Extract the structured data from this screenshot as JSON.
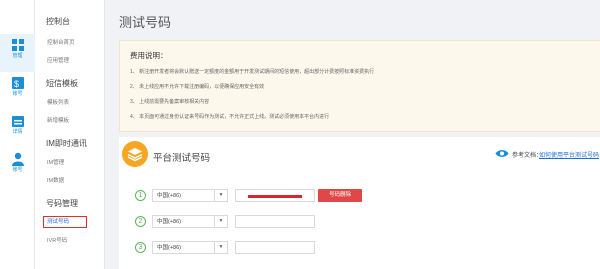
{
  "rail": [
    {
      "label": "管理",
      "icon": "grid-icon",
      "active": true
    },
    {
      "label": "账号",
      "icon": "account-icon",
      "active": false
    },
    {
      "label": "详情",
      "icon": "calendar-icon",
      "active": false
    },
    {
      "label": "账号",
      "icon": "user-icon",
      "active": false
    }
  ],
  "sidebar": {
    "sections": [
      {
        "title": "控制台",
        "items": [
          "控制台首页",
          "应用管理"
        ]
      },
      {
        "title": "短信模板",
        "items": [
          "模板列表",
          "新增模板"
        ]
      },
      {
        "title": "IM即时通讯",
        "items": [
          "IM管理",
          "IM数据"
        ]
      },
      {
        "title": "号码管理",
        "items": [
          "测试号码",
          "IVR号码"
        ]
      }
    ]
  },
  "page": {
    "title": "测试号码",
    "notice": {
      "title": "费用说明：",
      "lines": [
        "1、 新注册开发者将会默认赠送一定额度的金额用于开发测试期间的短信使用，超出部分计费按照标准资费执行",
        "2、 未上线应用不允许下载注册编码，以便确保应用安全有效",
        "3、 上线前需要先备案审核相关内容",
        "4、 本页面可通过身份认证来号码作为测试，不允许正式上线。测试必须使用本平台内进行"
      ]
    },
    "section": {
      "title": "平台测试号码",
      "ref_label": "参考文档：",
      "ref_link": "如何使用平台测试号码"
    },
    "rows": [
      {
        "num": "1",
        "country": "中国(+86)",
        "has_value": true,
        "button": "号码删除"
      },
      {
        "num": "2",
        "country": "中国(+86)",
        "has_value": false
      },
      {
        "num": "3",
        "country": "中国(+86)",
        "has_value": false
      }
    ]
  },
  "colors": {
    "accent": "#1a8fd8",
    "danger": "#e04848",
    "orange": "#f5a623",
    "green": "#5cb85c"
  }
}
